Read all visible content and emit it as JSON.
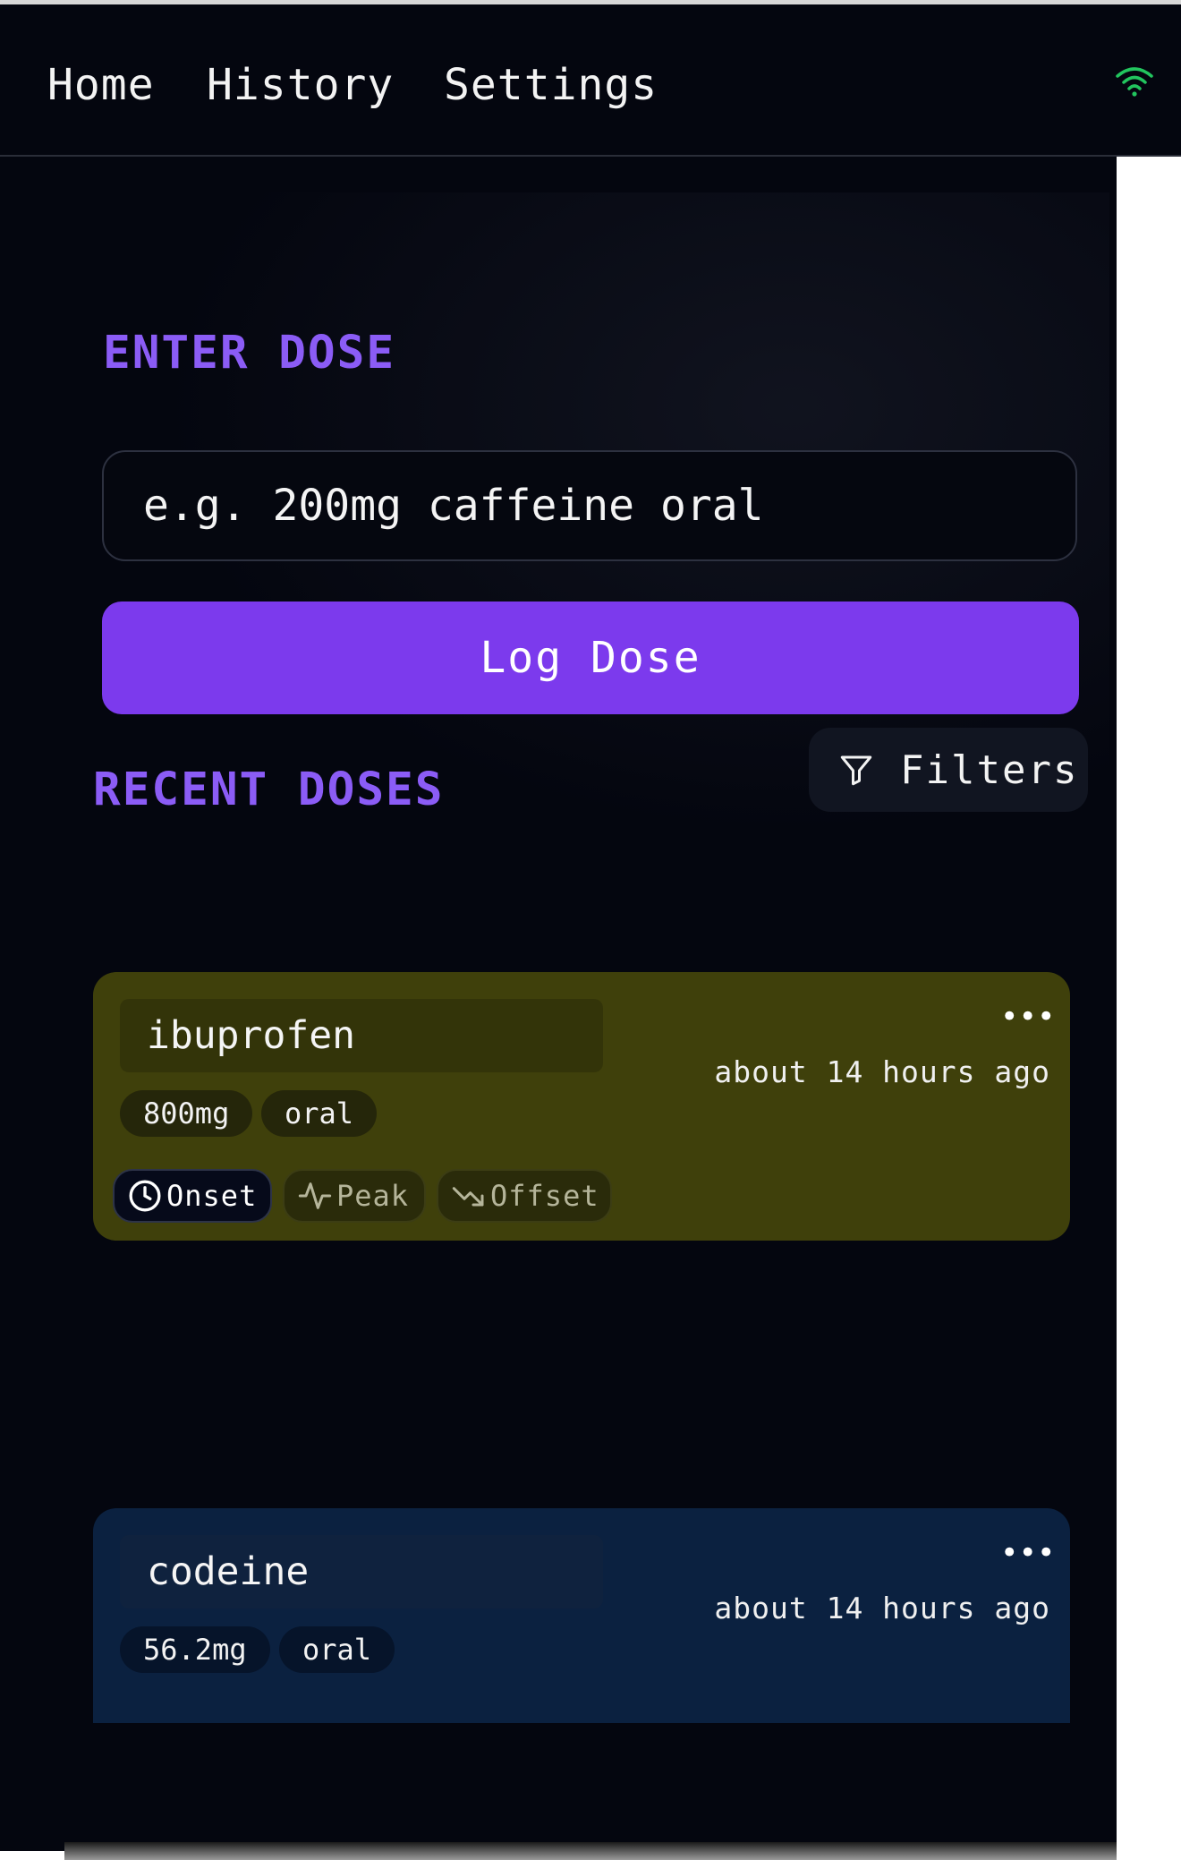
{
  "nav": {
    "items": [
      {
        "label": "Home"
      },
      {
        "label": "History"
      },
      {
        "label": "Settings"
      }
    ],
    "status_icon": "wifi-icon",
    "status_color": "#22c55e"
  },
  "enter_dose": {
    "title": "ENTER DOSE",
    "input_value": "",
    "input_placeholder": "e.g. 200mg caffeine oral",
    "button_label": "Log Dose"
  },
  "recent": {
    "title": "RECENT DOSES",
    "filters_label": "Filters",
    "filters_icon": "filter-icon"
  },
  "doses": [
    {
      "name": "ibuprofen",
      "amount": "800mg",
      "route": "oral",
      "time_ago": "about 14 hours ago",
      "menu": "•••",
      "color": "#3f400b",
      "phases": [
        {
          "label": "Onset",
          "icon": "clock-icon",
          "active": true
        },
        {
          "label": "Peak",
          "icon": "activity-icon",
          "active": false
        },
        {
          "label": "Offset",
          "icon": "trending-down-icon",
          "active": false
        }
      ]
    },
    {
      "name": "codeine",
      "amount": "56.2mg",
      "route": "oral",
      "time_ago": "about 14 hours ago",
      "menu": "•••",
      "color": "#0b2140"
    }
  ],
  "colors": {
    "accent": "#7c3aed",
    "section_title": "#8b5cf6",
    "background": "#04060f"
  }
}
